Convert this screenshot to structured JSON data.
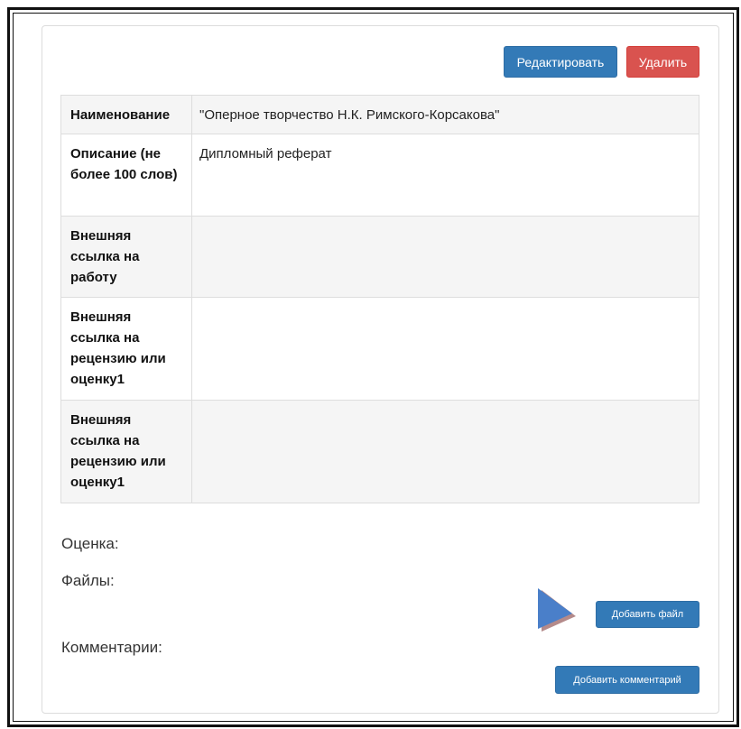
{
  "toolbar": {
    "edit_label": "Редактировать",
    "delete_label": "Удалить"
  },
  "details": {
    "rows": [
      {
        "label": "Наименование",
        "value": "\"Оперное творчество Н.К. Римского-Корсакова\""
      },
      {
        "label": "Описание (не более 100 слов)",
        "value": "Дипломный реферат"
      },
      {
        "label": "Внешняя ссылка на работу",
        "value": ""
      },
      {
        "label": "Внешняя ссылка на рецензию или оценку1",
        "value": ""
      },
      {
        "label": "Внешняя ссылка на рецензию или оценку1",
        "value": ""
      }
    ]
  },
  "sections": {
    "grade_label": "Оценка:",
    "files_label": "Файлы:",
    "comments_label": "Комментарии:"
  },
  "actions": {
    "add_file_label": "Добавить файл",
    "add_comment_label": "Добавить комментарий"
  },
  "colors": {
    "primary": "#337ab7",
    "danger": "#d9534f",
    "pointer_arrow": "#4a7fc9"
  },
  "icons": {
    "pointer": "arrow-pointer-icon"
  }
}
